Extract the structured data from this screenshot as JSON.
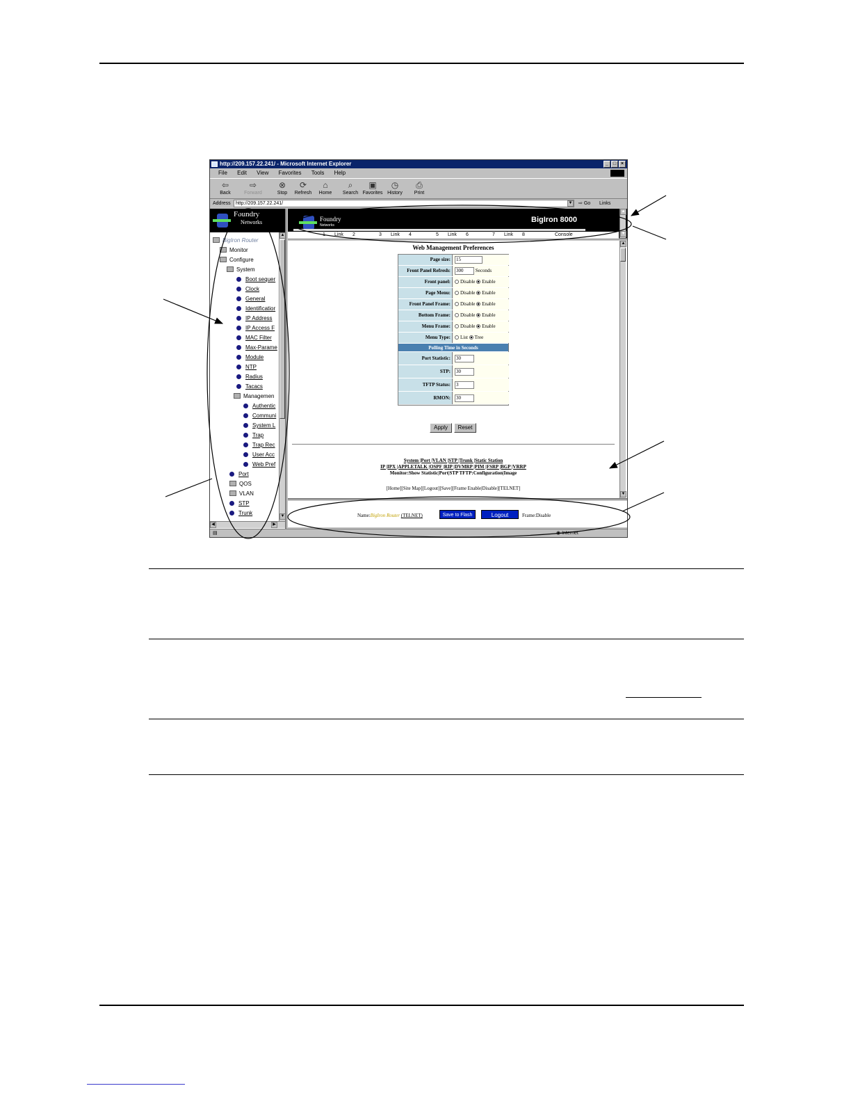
{
  "browser": {
    "title": "http://209.157.22.241/ - Microsoft Internet Explorer",
    "menu": [
      "File",
      "Edit",
      "View",
      "Favorites",
      "Tools",
      "Help"
    ],
    "toolbar": [
      "Back",
      "Forward",
      "Stop",
      "Refresh",
      "Home",
      "Search",
      "Favorites",
      "History",
      "Print"
    ],
    "address_label": "Address",
    "address": "http://209.157.22.241/",
    "go": "Go",
    "links": "Links",
    "status_zone": "Internet"
  },
  "left_frame": {
    "logo_line1": "Foundry",
    "logo_line2": "Networks",
    "tree": {
      "root": "BigIron Router",
      "monitor": "Monitor",
      "configure": "Configure",
      "system": "System",
      "system_items": [
        "Boot sequer",
        "Clock",
        "General",
        "Identificatior",
        "IP Address",
        "IP Access F",
        "MAC Filter",
        "Max-Parame",
        "Module",
        "NTP",
        "Radius",
        "Tacacs"
      ],
      "management": "Managemen",
      "management_items": [
        "Authentic",
        "Communi",
        "System L",
        "Trap",
        "Trap Rec",
        "User Acc",
        "Web Pref"
      ],
      "bottom_items": [
        "Port",
        "QOS",
        "VLAN",
        "STP",
        "Trunk"
      ]
    }
  },
  "top_frame": {
    "brand_line1": "Foundry",
    "brand_line2": "Networks",
    "model": "BigIron 8000",
    "ports": [
      "1",
      "Link",
      "2",
      "3",
      "Link",
      "4",
      "5",
      "Link",
      "6",
      "7",
      "Link",
      "8",
      "Console"
    ]
  },
  "main_frame": {
    "title": "Web Management Preferences",
    "rows": {
      "page_size": {
        "label": "Page size:",
        "value": "15"
      },
      "front_panel_refresh": {
        "label": "Front Panel Refresh:",
        "value": "300",
        "unit": "Seconds"
      },
      "front_panel": {
        "label": "Front panel:"
      },
      "page_menu": {
        "label": "Page Menu:"
      },
      "front_panel_frame": {
        "label": "Front Panel Frame:"
      },
      "bottom_frame": {
        "label": "Bottom Frame:"
      },
      "menu_frame": {
        "label": "Menu Frame:"
      },
      "menu_type": {
        "label": "Menu Type:",
        "opt1": "List",
        "opt2": "Tree"
      },
      "disable": "Disable",
      "enable": "Enable",
      "polling_header": "Polling Time in Seconds",
      "port_statistic": {
        "label": "Port Statistic:",
        "value": "30"
      },
      "stp": {
        "label": "STP:",
        "value": "30"
      },
      "tftp_status": {
        "label": "TFTP Status:",
        "value": "3"
      },
      "rmon": {
        "label": "RMON:",
        "value": "30"
      }
    },
    "apply": "Apply",
    "reset": "Reset",
    "nav1": "System |Port |VLAN |STP |Trunk |Static Station",
    "nav2": "IP |IPX |APPLETALK |OSPF |RIP |DVMRP |PIM |FSRP |BGP |VRRP",
    "nav3": "Monitor:Show Statistic|Port|STP TFTP:Configuration|Image",
    "nav4": "[Home][Site Map][Logout][Save][Frame Enable|Disable][TELNET]"
  },
  "bottom_frame": {
    "name_label": "Name:",
    "name_value": "BigIron Router",
    "telnet": "(TELNET)",
    "save": "Save to Flash",
    "logout": "Logout",
    "frame": "Frame:Disable"
  },
  "colors": {
    "titlebar": "#0a246a",
    "button_blue": "#0020c0",
    "table_label": "#c8e0e8",
    "polling_header": "#4a80b0"
  }
}
